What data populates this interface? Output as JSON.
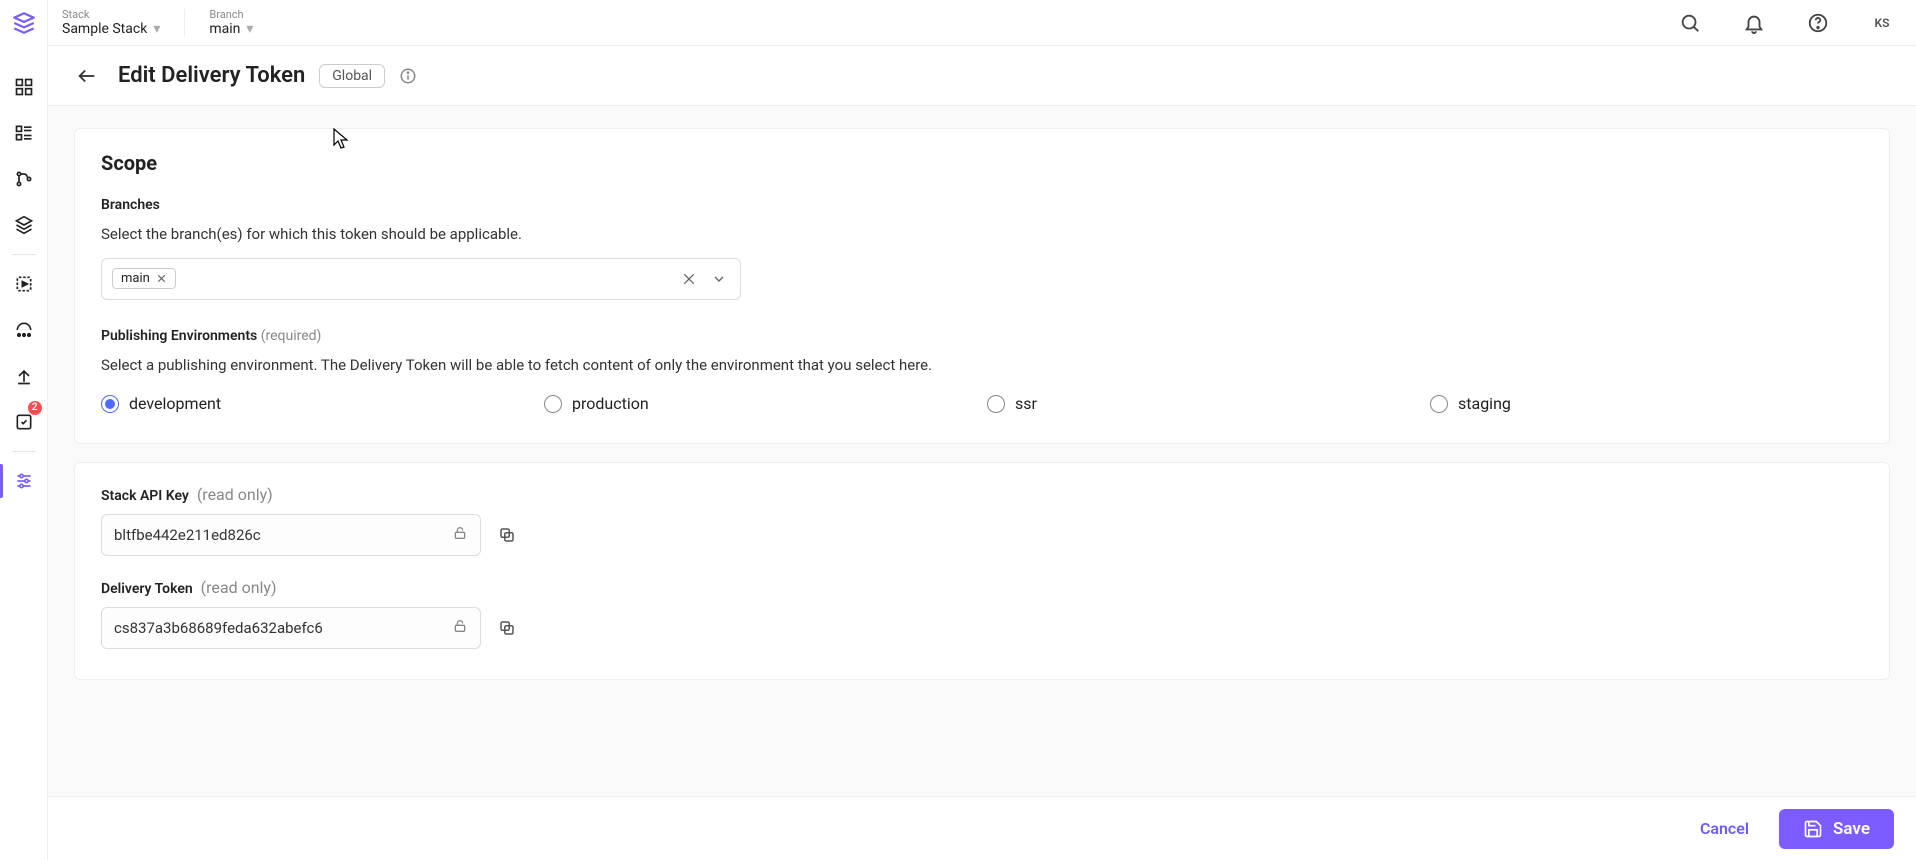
{
  "topbar": {
    "stack_label": "Stack",
    "stack_value": "Sample Stack",
    "branch_label": "Branch",
    "branch_value": "main",
    "avatar": "KS"
  },
  "header": {
    "title": "Edit Delivery Token",
    "pill": "Global"
  },
  "scope": {
    "title": "Scope",
    "branches_label": "Branches",
    "branches_help": "Select the branch(es) for which this token should be applicable.",
    "chip": "main",
    "env_label": "Publishing Environments",
    "env_required": "(required)",
    "env_help": "Select a publishing environment. The Delivery Token will be able to fetch content of only the environment that you select here.",
    "envs": [
      "development",
      "production",
      "ssr",
      "staging"
    ],
    "env_selected": "development"
  },
  "keys": {
    "api_label": "Stack API Key",
    "api_note": "(read only)",
    "api_value": "bltfbe442e211ed826c",
    "token_label": "Delivery Token",
    "token_note": "(read only)",
    "token_value": "cs837a3b68689feda632abefc6"
  },
  "footer": {
    "cancel": "Cancel",
    "save": "Save"
  },
  "rail": {
    "notification_badge": "2"
  }
}
